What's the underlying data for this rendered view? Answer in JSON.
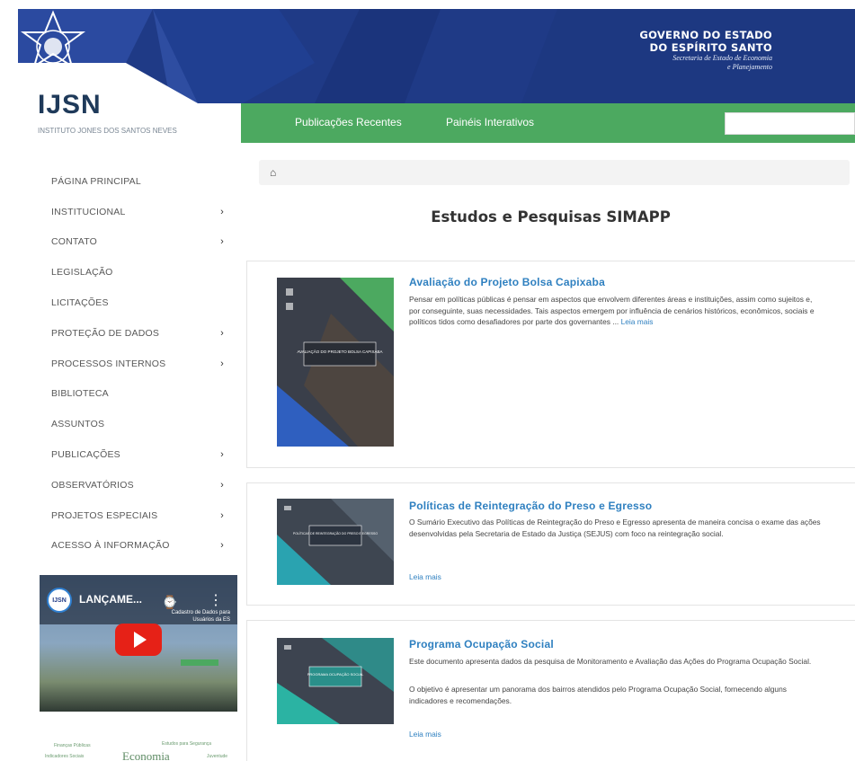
{
  "header": {
    "gov_line1": "GOVERNO DO ESTADO",
    "gov_line2": "DO ESPÍRITO SANTO",
    "gov_line3": "Secretaria de Estado de Economia",
    "gov_line4": "e Planejamento",
    "colors": {
      "banner": "#1f3a86",
      "nav": "#4ca960"
    }
  },
  "nav": {
    "items": [
      {
        "label": "Publicações Recentes"
      },
      {
        "label": "Painéis Interativos"
      }
    ],
    "search_placeholder": ""
  },
  "logo": {
    "title": "IJSN",
    "subtitle": "INSTITUTO JONES DOS SANTOS NEVES"
  },
  "sidebar": {
    "items": [
      {
        "label": "PÁGINA PRINCIPAL",
        "has_submenu": false
      },
      {
        "label": "INSTITUCIONAL",
        "has_submenu": true
      },
      {
        "label": "CONTATO",
        "has_submenu": true
      },
      {
        "label": "LEGISLAÇÃO",
        "has_submenu": false
      },
      {
        "label": "LICITAÇÕES",
        "has_submenu": false
      },
      {
        "label": "PROTEÇÃO DE DADOS",
        "has_submenu": true
      },
      {
        "label": "PROCESSOS INTERNOS",
        "has_submenu": true
      },
      {
        "label": "BIBLIOTECA",
        "has_submenu": false
      },
      {
        "label": "ASSUNTOS",
        "has_submenu": false
      },
      {
        "label": "PUBLICAÇÕES",
        "has_submenu": true
      },
      {
        "label": "OBSERVATÓRIOS",
        "has_submenu": true
      },
      {
        "label": "PROJETOS ESPECIAIS",
        "has_submenu": true
      },
      {
        "label": "ACESSO À INFORMAÇÃO",
        "has_submenu": true
      }
    ],
    "chevron": "›"
  },
  "video": {
    "channel": "IJSN",
    "title": "LANÇAME...",
    "badge_text": "Cadastro de Dados para Usuários da ES"
  },
  "wordcloud": {
    "words": [
      "Finanças Públicas",
      "Estudos para Segurança",
      "Economia",
      "Indicadores Sociais",
      "Juventude"
    ]
  },
  "main": {
    "home_icon": "home-icon",
    "page_title": "Estudos e Pesquisas SIMAPP",
    "read_more": "Leia mais",
    "cards": [
      {
        "title": "Avaliação do Projeto Bolsa Capixaba",
        "text": "Pensar em políticas públicas é pensar em aspectos que envolvem diferentes áreas e instituições, assim como sujeitos e, por conseguinte, suas necessidades. Tais aspectos emergem por influência de cenários históricos, econômicos, sociais e políticos tidos como desafiadores por parte dos governantes ...",
        "cover_title": "AVALIAÇÃO DO PROJETO BOLSA CAPIXABA"
      },
      {
        "title": "Políticas de Reintegração do Preso e Egresso",
        "text": "O Sumário Executivo das Políticas de Reintegração do Preso e Egresso apresenta de maneira concisa o exame das ações desenvolvidas pela Secretaria de Estado da Justiça (SEJUS) com foco na reintegração social.",
        "cover_title": "POLÍTICAS DE REINTEGRAÇÃO DO PRESO E EGRESSO"
      },
      {
        "title": "Programa Ocupação Social",
        "text": "Este documento apresenta dados da pesquisa de Monitoramento e Avaliação das Ações do Programa Ocupação Social.",
        "text2": "O objetivo é apresentar um panorama dos bairros atendidos pelo Programa Ocupação Social, fornecendo alguns indicadores e recomendações.",
        "cover_title": "PROGRAMA OCUPAÇÃO SOCIAL"
      }
    ]
  }
}
